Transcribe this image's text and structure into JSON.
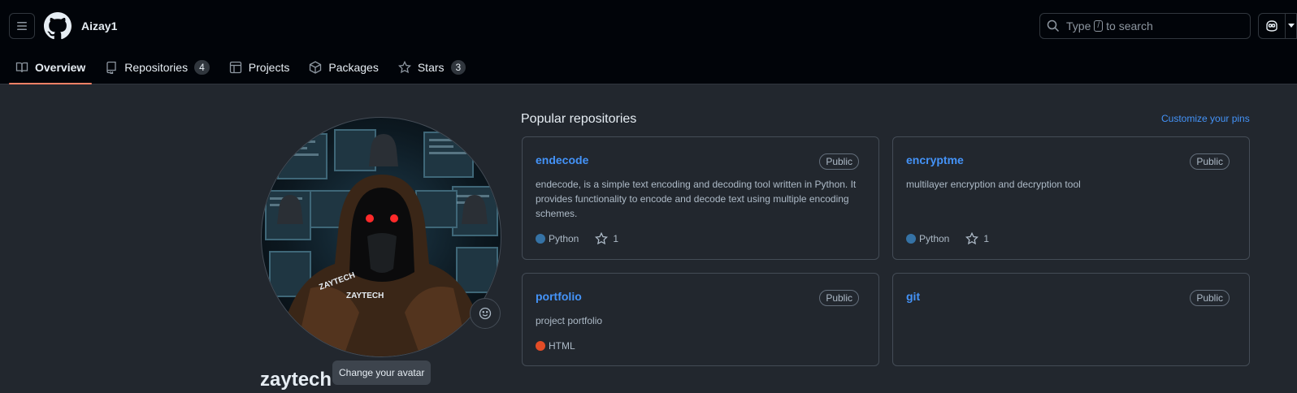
{
  "header": {
    "username": "Aizay1",
    "search": {
      "prefix": "Type",
      "key": "/",
      "suffix": "to search"
    }
  },
  "tabs": [
    {
      "label": "Overview",
      "icon": "book-icon",
      "active": true
    },
    {
      "label": "Repositories",
      "icon": "repo-icon",
      "count": "4"
    },
    {
      "label": "Projects",
      "icon": "table-icon"
    },
    {
      "label": "Packages",
      "icon": "package-icon"
    },
    {
      "label": "Stars",
      "icon": "star-icon",
      "count": "3"
    }
  ],
  "profile": {
    "fullname": "zaytech",
    "avatar_tooltip": "Change your avatar",
    "avatar_text": "ZAYTECH"
  },
  "popular": {
    "title": "Popular repositories",
    "customize": "Customize your pins",
    "repos": [
      {
        "name": "endecode",
        "badge": "Public",
        "description": "endecode, is a simple text encoding and decoding tool written in Python. It provides functionality to encode and decode text using multiple encoding schemes.",
        "language": "Python",
        "language_color": "#3572A5",
        "stars": "1"
      },
      {
        "name": "encryptme",
        "badge": "Public",
        "description": "multilayer encryption and decryption tool",
        "language": "Python",
        "language_color": "#3572A5",
        "stars": "1"
      },
      {
        "name": "portfolio",
        "badge": "Public",
        "description": "project portfolio",
        "language": "HTML",
        "language_color": "#e34c26"
      },
      {
        "name": "git",
        "badge": "Public"
      }
    ]
  },
  "colors": {
    "accent": "#4493f8",
    "tab_underline": "#f78166"
  }
}
